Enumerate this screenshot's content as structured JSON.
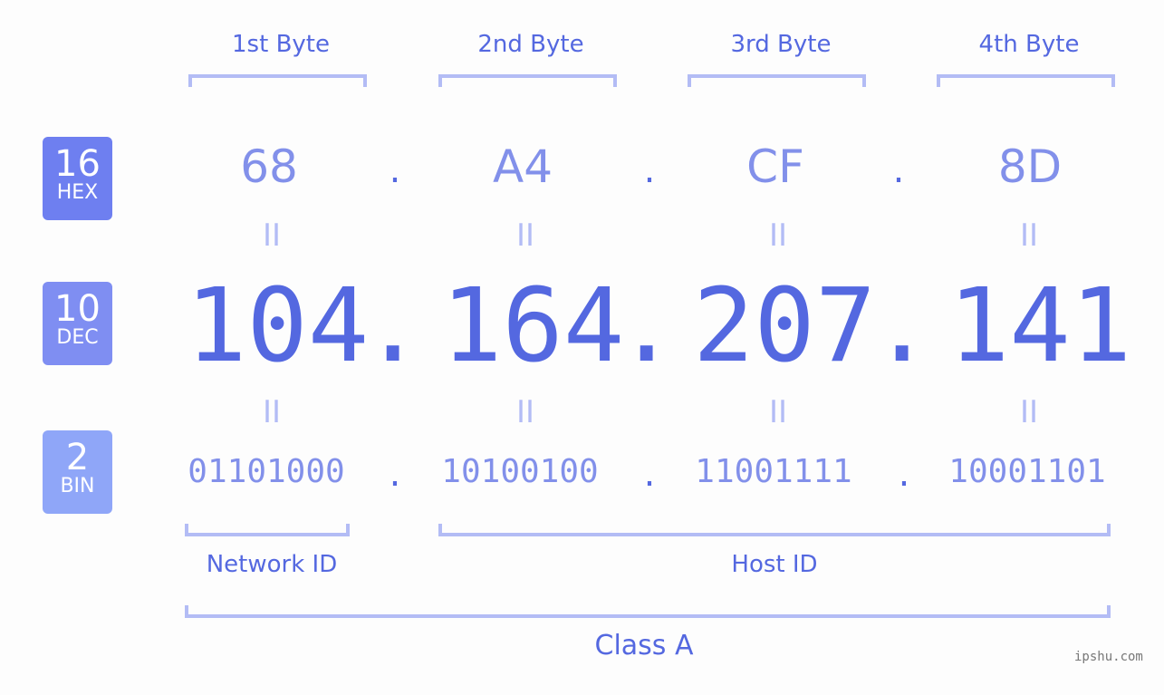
{
  "bytes": [
    {
      "label": "1st Byte",
      "hex": "68",
      "dec": "104",
      "bin": "01101000"
    },
    {
      "label": "2nd Byte",
      "hex": "A4",
      "dec": "164",
      "bin": "10100100"
    },
    {
      "label": "3rd Byte",
      "hex": "CF",
      "dec": "207",
      "bin": "11001111"
    },
    {
      "label": "4th Byte",
      "hex": "8D",
      "dec": "141",
      "bin": "10001101"
    }
  ],
  "badges": {
    "hex": {
      "num": "16",
      "label": "HEX",
      "color": "#6e7ff0"
    },
    "dec": {
      "num": "10",
      "label": "DEC",
      "color": "#7f8ef2"
    },
    "bin": {
      "num": "2",
      "label": "BIN",
      "color": "#8fa6f8"
    }
  },
  "separator": ".",
  "equals": "II",
  "network_id_label": "Network ID",
  "host_id_label": "Host ID",
  "class_label": "Class A",
  "watermark": "ipshu.com"
}
